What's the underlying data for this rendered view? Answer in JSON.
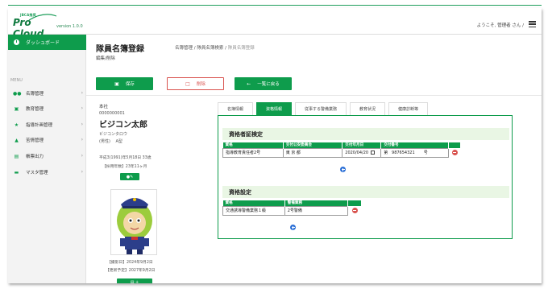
{
  "header": {
    "logo_small": "JBCA推奨",
    "logo_main": "Pro Cloud",
    "version": "version 1.0.0",
    "welcome": "ようこそ, 管理者 さん /"
  },
  "sidebar": {
    "dashboard": "ダッシュボード",
    "menu_label": "MENU",
    "items": [
      {
        "label": "名簿管理",
        "icon": "users-icon"
      },
      {
        "label": "教育管理",
        "icon": "sitemap-icon"
      },
      {
        "label": "指導計画管理",
        "icon": "star-icon"
      },
      {
        "label": "苦情管理",
        "icon": "megaphone-icon"
      },
      {
        "label": "帳票出力",
        "icon": "printer-icon"
      },
      {
        "label": "マスタ管理",
        "icon": "folder-icon"
      }
    ]
  },
  "page": {
    "title": "隊員名簿登録",
    "breadcrumb": [
      "名簿管理",
      "隊員名簿検索",
      "隊員名簿登録"
    ],
    "subtitle": "編集/削除"
  },
  "toolbar": {
    "save": "保存",
    "delete": "削除",
    "back": "一覧に戻る"
  },
  "profile": {
    "branch": "本社",
    "id": "0000000001",
    "name": "ビジコン太郎",
    "kana": "ビジコンタロウ",
    "sex_blood": "(男性)　 A型",
    "birth": "平成3(1991)年5月18日 33歳",
    "hire": "【採用年数】23年11ヶ月",
    "shot_date": "【撮影日】2024年9月2日",
    "renew_date": "【更新予定】2027年9月2日"
  },
  "tabs": [
    "名簿情報",
    "資格情報",
    "従事する警備業務",
    "教育状況",
    "健康診断等"
  ],
  "active_tab": 1,
  "qualification_cert": {
    "title": "資格者証検定",
    "headers": [
      "資格",
      "交付公安委員会",
      "交付年月日",
      "交付番号"
    ],
    "rows": [
      {
        "qual": "指導教育責任者2号",
        "committee": "東 京 都",
        "date": "2020/04/20",
        "prefix": "第",
        "number": "987654321",
        "suffix": "号"
      }
    ]
  },
  "qualification_setting": {
    "title": "資格設定",
    "headers": [
      "資格",
      "警備業務"
    ],
    "rows": [
      {
        "qual": "交通誘導警備業務１級",
        "duty": "2号警備"
      }
    ]
  }
}
